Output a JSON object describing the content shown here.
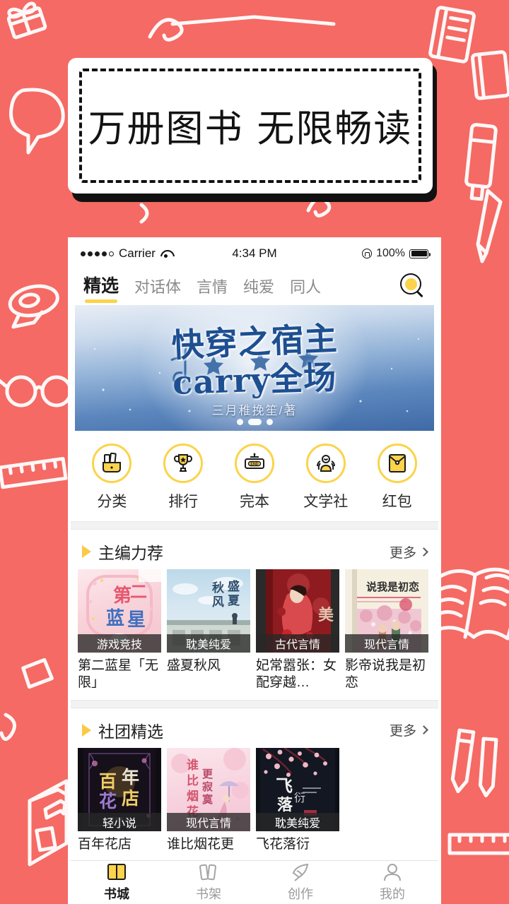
{
  "page": {
    "background_color": "#f56a64",
    "accent_yellow": "#fcd34a"
  },
  "promo": {
    "headline": "万册图书  无限畅读"
  },
  "status_bar": {
    "carrier": "Carrier",
    "time": "4:34 PM",
    "battery_percent": "100%"
  },
  "nav": {
    "tabs": [
      {
        "label": "精选",
        "active": true
      },
      {
        "label": "对话体",
        "active": false
      },
      {
        "label": "言情",
        "active": false
      },
      {
        "label": "纯爱",
        "active": false
      },
      {
        "label": "同人",
        "active": false
      }
    ],
    "search_icon": "search-icon"
  },
  "banner": {
    "title": "快穿之宿主",
    "subtitle": "carry全场",
    "author": "三月稚挽笙/著",
    "dots": [
      false,
      true,
      false
    ]
  },
  "quick_links": [
    {
      "label": "分类",
      "icon": "books-bag-icon"
    },
    {
      "label": "排行",
      "icon": "trophy-icon"
    },
    {
      "label": "完本",
      "icon": "end-sign-icon"
    },
    {
      "label": "文学社",
      "icon": "people-group-icon"
    },
    {
      "label": "红包",
      "icon": "red-envelope-icon"
    }
  ],
  "sections": [
    {
      "title": "主编力荐",
      "more_label": "更多",
      "books": [
        {
          "title": "第二蓝星「无限」",
          "tag": "游戏竞技",
          "cover": "pink-ornate"
        },
        {
          "title": "盛夏秋风",
          "tag": "耽美纯爱",
          "cover": "blue-sky"
        },
        {
          "title": "妃常嚣张：女配穿越…",
          "tag": "古代言情",
          "cover": "red-hanfu"
        },
        {
          "title": "影帝说我是初恋",
          "tag": "现代言情",
          "cover": "cream-sakura"
        }
      ]
    },
    {
      "title": "社团精选",
      "more_label": "更多",
      "books": [
        {
          "title": "百年花店",
          "tag": "轻小说",
          "cover": "dark-gold"
        },
        {
          "title": "谁比烟花更",
          "tag": "现代言情",
          "cover": "pink-umbrella"
        },
        {
          "title": "飞花落衍",
          "tag": "耽美纯爱",
          "cover": "dark-blossom"
        }
      ]
    }
  ],
  "tabbar": [
    {
      "label": "书城",
      "icon": "open-book-icon",
      "active": true
    },
    {
      "label": "书架",
      "icon": "bookshelf-icon",
      "active": false
    },
    {
      "label": "创作",
      "icon": "quill-icon",
      "active": false
    },
    {
      "label": "我的",
      "icon": "person-icon",
      "active": false
    }
  ]
}
